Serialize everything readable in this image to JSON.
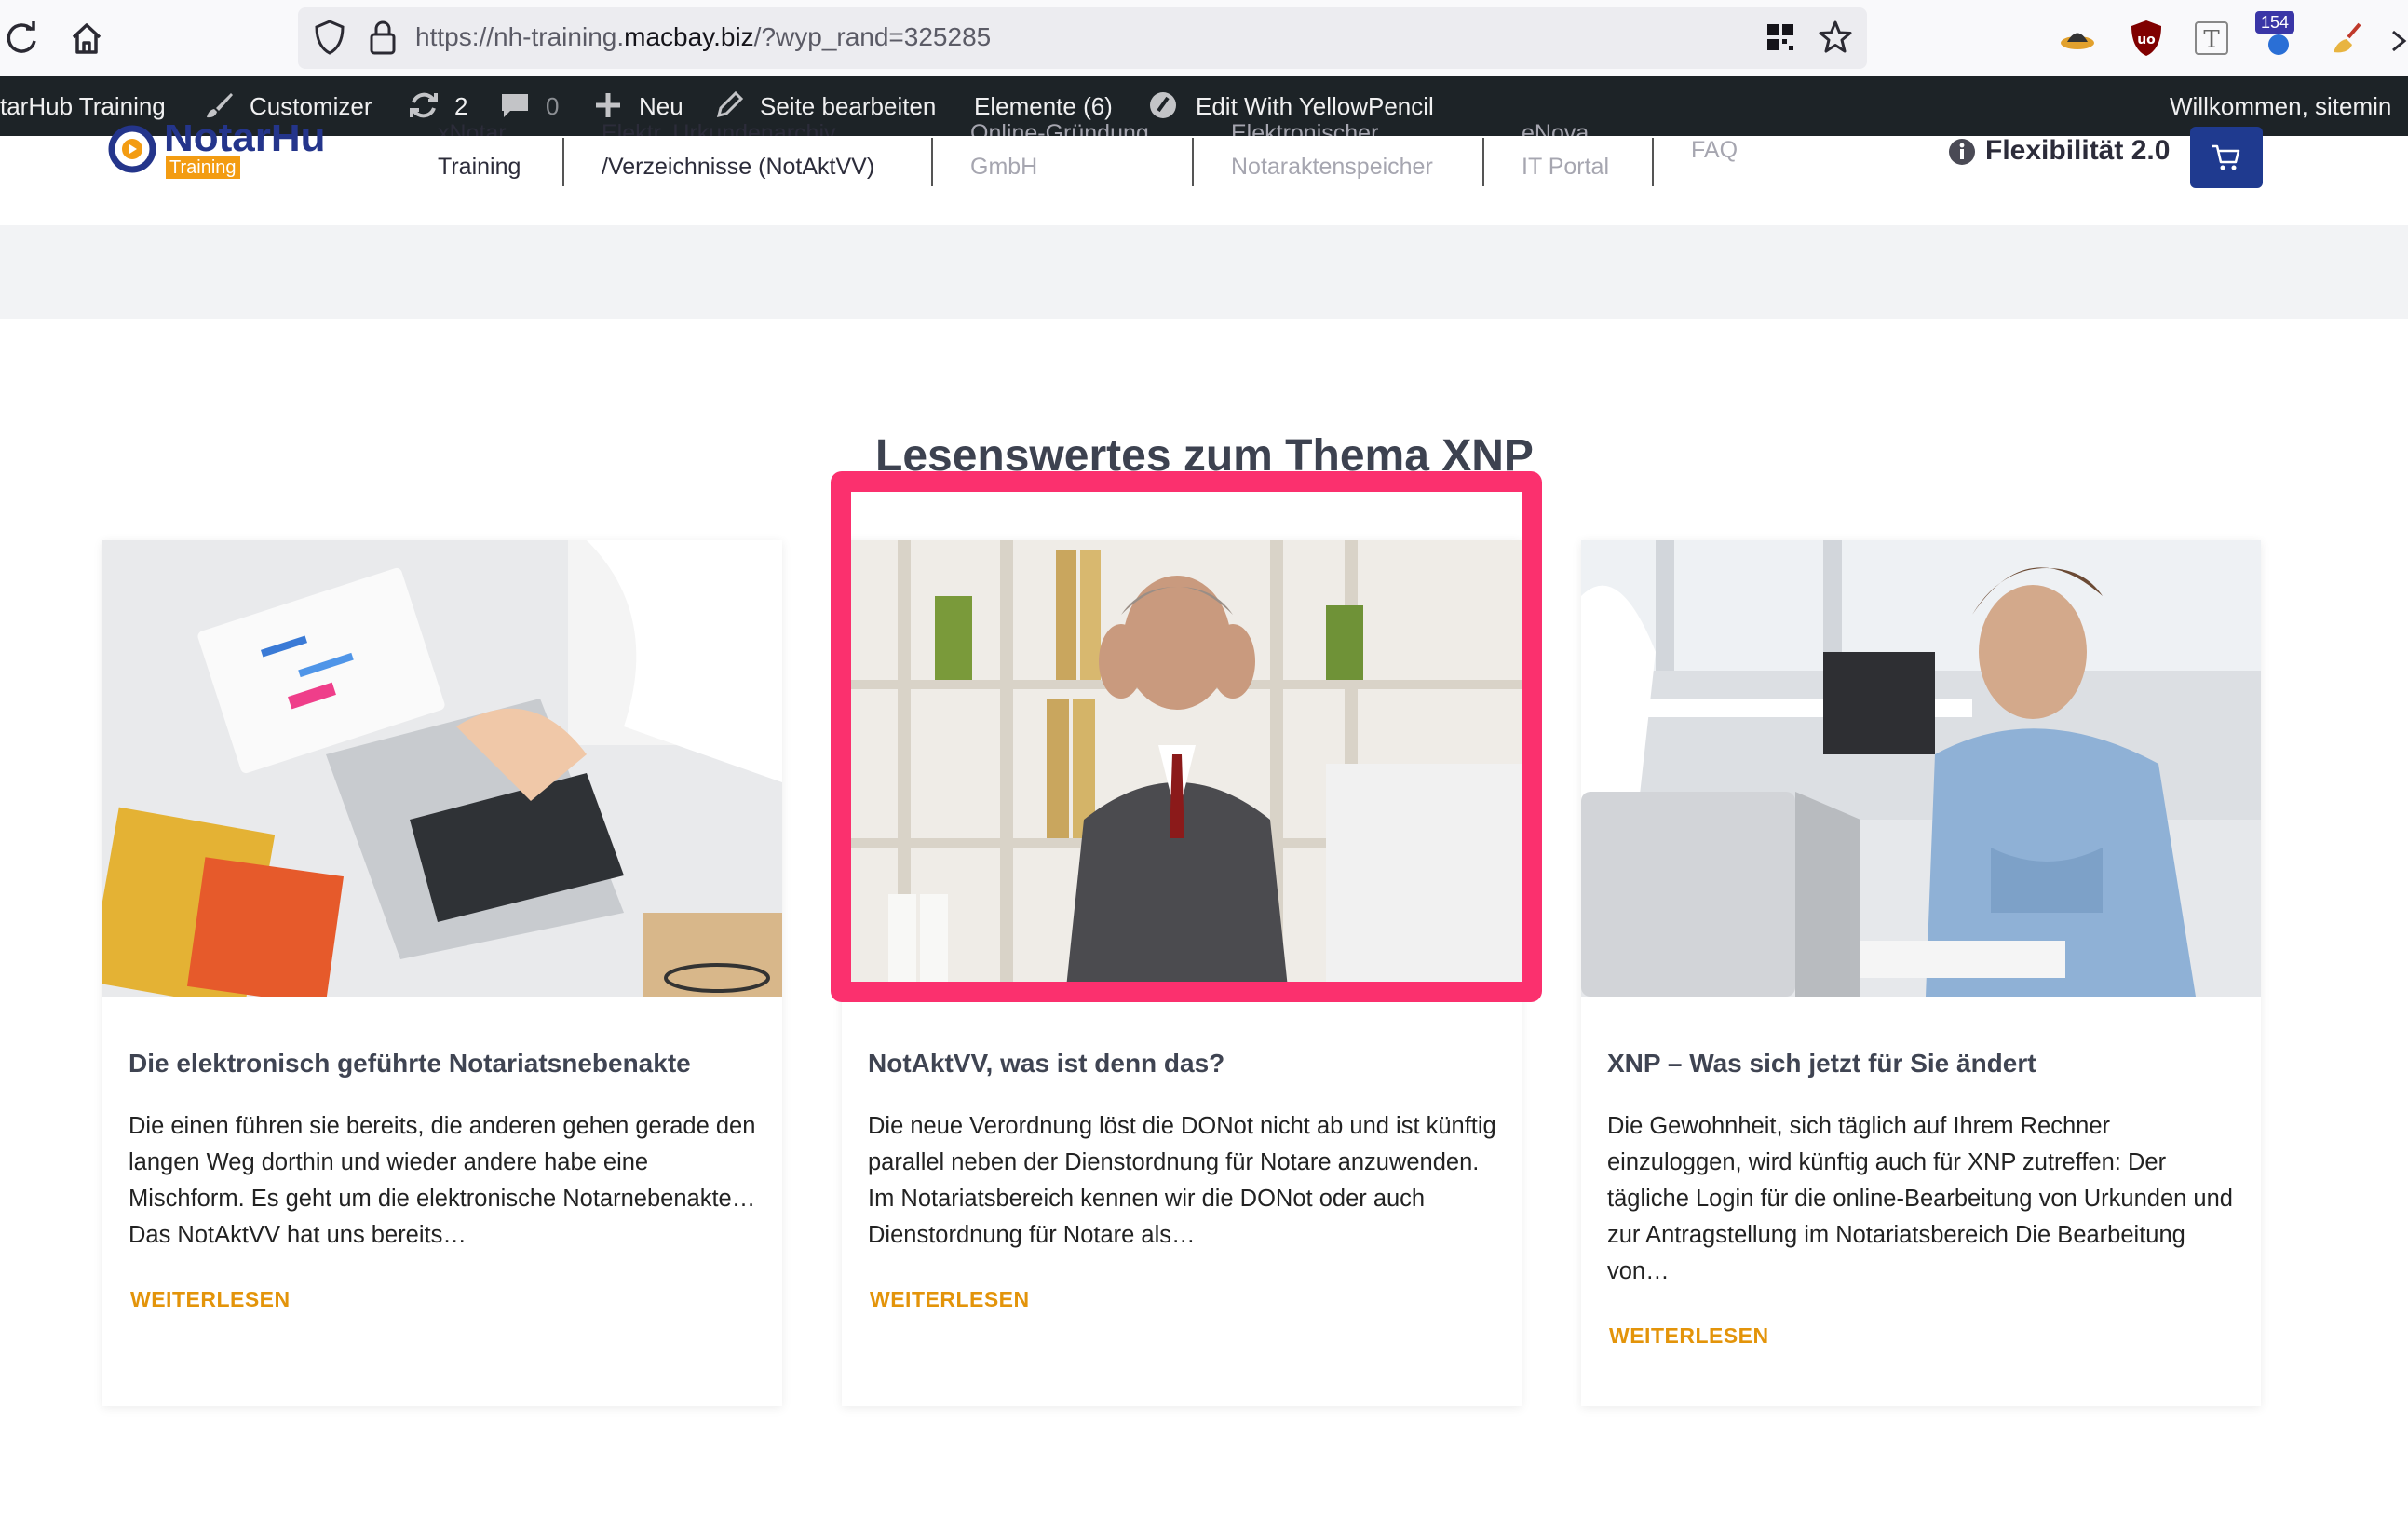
{
  "browser": {
    "url_prefix": "https://nh-training.",
    "url_domain": "macbay.biz",
    "url_suffix": "/?wyp_rand=325285",
    "extension_badge": "154"
  },
  "admin_bar": {
    "site": "tarHub Training",
    "customizer": "Customizer",
    "updates_count": "2",
    "comments_count": "0",
    "new": "Neu",
    "edit_page": "Seite bearbeiten",
    "elements": "Elemente (6)",
    "yellowpencil": "Edit With YellowPencil",
    "welcome": "Willkommen, sitemin"
  },
  "header": {
    "logo_text": "NotarHub",
    "logo_badge": "Training",
    "nav": [
      {
        "line1": "xNotar",
        "line2": "Training"
      },
      {
        "line1": "Elektr. Urkundenarchiv",
        "line2": "/Verzeichnisse (NotAktVV)"
      },
      {
        "line1": "Online-Gründung",
        "line2": "GmbH"
      },
      {
        "line1": "Elektronischer",
        "line2": "Notaraktenspeicher"
      },
      {
        "line1": "eNova",
        "line2": "IT Portal"
      },
      {
        "line1": "FAQ",
        "line2": ""
      }
    ],
    "flex_label": "Flexibilität 2.0"
  },
  "section": {
    "title": "Lesenswertes zum Thema XNP"
  },
  "cards": [
    {
      "title": "Die elektronisch geführte Notariatsnebenakte",
      "text": "Die einen führen sie bereits, die anderen gehen gerade den langen Weg dorthin und wieder andere habe eine Mischform. Es geht um die elektronische Notarnebenakte… Das NotAktVV hat uns bereits…",
      "link": "WEITERLESEN"
    },
    {
      "title": "NotAktVV, was ist denn das?",
      "text": "Die neue Verordnung löst die DONot nicht ab und ist künftig parallel neben der Dienstordnung für Notare anzuwenden. Im Notariatsbereich kennen wir die DONot oder auch Dienstordnung für Notare als…",
      "link": "WEITERLESEN"
    },
    {
      "title": "XNP – Was sich jetzt für Sie ändert",
      "text": "Die Gewohnheit, sich täglich auf Ihrem Rechner einzuloggen, wird künftig auch für XNP zutreffen: Der tägliche Login für die online-Bearbeitung von Urkunden und zur Antragstellung im Notariatsbereich Die Bearbeitung von…",
      "link": "WEITERLESEN"
    }
  ],
  "colors": {
    "accent_link": "#e3940a",
    "highlight": "#fb306e",
    "cart_button": "#1f3a8f",
    "admin_bar": "#1d2327"
  }
}
